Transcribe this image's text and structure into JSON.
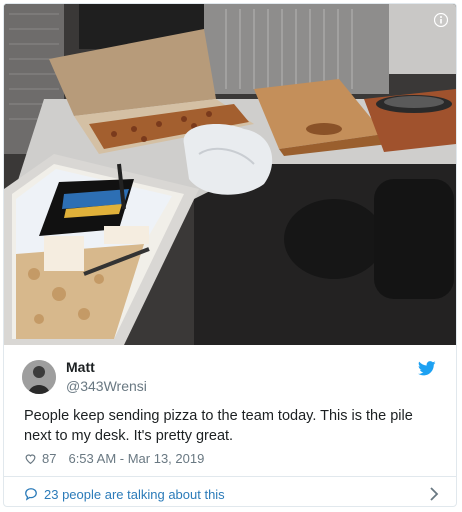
{
  "author": {
    "name": "Matt",
    "handle": "@343Wrensi"
  },
  "tweet": {
    "text": "People keep sending pizza to the team today. This is the pile next to my desk. It's pretty great.",
    "likes": "87",
    "timestamp": "6:53 AM - Mar 13, 2019"
  },
  "footer": {
    "talking": "23 people are talking about this"
  },
  "colors": {
    "link": "#2b7bb9",
    "twitter_blue": "#1da1f2",
    "meta": "#697882"
  },
  "icons": [
    "info-icon",
    "twitter-bird-icon",
    "heart-icon",
    "comment-bubble-icon",
    "chevron-right-icon"
  ]
}
